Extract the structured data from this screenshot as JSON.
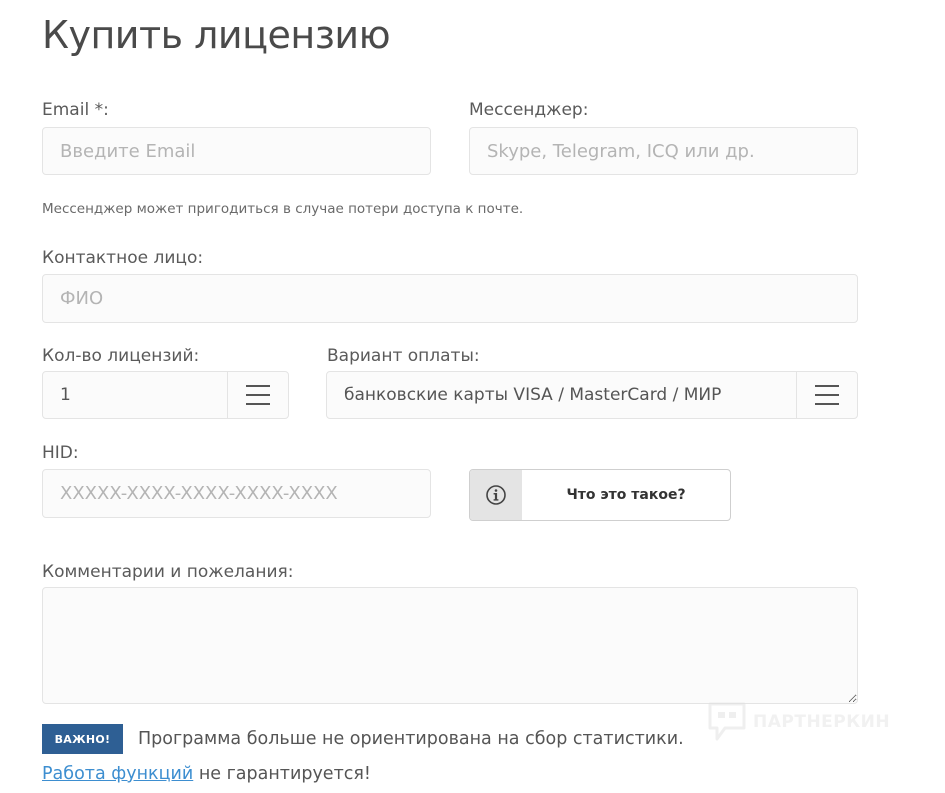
{
  "page": {
    "title": "Купить лицензию"
  },
  "form": {
    "email": {
      "label": "Email *:",
      "placeholder": "Введите Email",
      "value": ""
    },
    "messenger": {
      "label": "Мессенджер:",
      "placeholder": "Skype, Telegram, ICQ или др.",
      "value": "",
      "hint": "Мессенджер может пригодиться в случае потери доступа к почте."
    },
    "contact": {
      "label": "Контактное лицо:",
      "placeholder": "ФИО",
      "value": ""
    },
    "license_count": {
      "label": "Кол-во лицензий:",
      "value": "1"
    },
    "payment": {
      "label": "Вариант оплаты:",
      "value": "банковские карты VISA / MasterCard / МИР"
    },
    "hid": {
      "label": "HID:",
      "placeholder": "XXXXX-XXXX-XXXX-XXXX-XXXX",
      "value": "",
      "help_button": "Что это такое?"
    },
    "comments": {
      "label": "Комментарии и пожелания:",
      "value": ""
    }
  },
  "notice": {
    "badge": "ВАЖНО!",
    "text": "Программа больше не ориентирована на сбор статистики.",
    "link_text": "Работа функций",
    "link_suffix": " не гарантируется!"
  },
  "watermark": {
    "text": "ПАРТНЕРКИН"
  },
  "icons": {
    "menu": "hamburger-icon",
    "info": "info-icon",
    "watermark": "chat-bubble-icon"
  },
  "colors": {
    "badge_bg": "#2e5f94",
    "link": "#3d8ed0",
    "field_border": "#e4e4e4",
    "field_bg": "#fbfbfb"
  }
}
